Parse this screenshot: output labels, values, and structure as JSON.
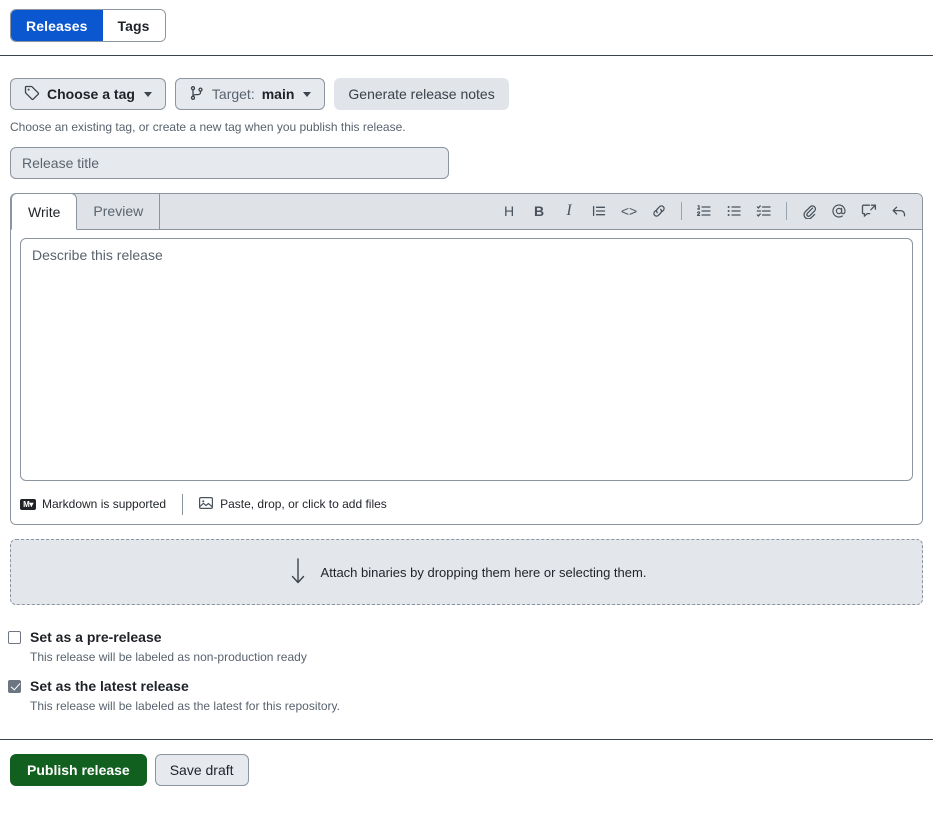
{
  "tabs": {
    "releases": "Releases",
    "tags": "Tags",
    "active": "Releases"
  },
  "tag_row": {
    "choose_tag": "Choose a tag",
    "target_label": "Target:",
    "target_value": "main",
    "generate_notes": "Generate release notes",
    "hint": "Choose an existing tag, or create a new tag when you publish this release."
  },
  "title_field": {
    "placeholder": "Release title",
    "value": ""
  },
  "editor": {
    "tab_write": "Write",
    "tab_preview": "Preview",
    "active_tab": "Write",
    "body_placeholder": "Describe this release",
    "body_value": "",
    "toolbar": [
      {
        "name": "heading-icon",
        "glyph": "H"
      },
      {
        "name": "bold-icon",
        "glyph": "B"
      },
      {
        "name": "italic-icon",
        "glyph": "I"
      },
      {
        "name": "quote-icon",
        "glyph": ""
      },
      {
        "name": "code-icon",
        "glyph": "<>"
      },
      {
        "name": "link-icon",
        "glyph": ""
      },
      {
        "name": "ordered-list-icon",
        "glyph": ""
      },
      {
        "name": "unordered-list-icon",
        "glyph": ""
      },
      {
        "name": "task-list-icon",
        "glyph": ""
      },
      {
        "name": "attach-file-icon",
        "glyph": ""
      },
      {
        "name": "mention-icon",
        "glyph": "@"
      },
      {
        "name": "cross-reference-icon",
        "glyph": ""
      },
      {
        "name": "saved-reply-icon",
        "glyph": ""
      }
    ],
    "footer": {
      "markdown_badge": "M",
      "markdown_text": "Markdown is supported",
      "attach_text": "Paste, drop, or click to add files"
    }
  },
  "dropzone": {
    "text": "Attach binaries by dropping them here or selecting them."
  },
  "options": [
    {
      "id": "pre-release",
      "label": "Set as a pre-release",
      "description": "This release will be labeled as non-production ready",
      "checked": false
    },
    {
      "id": "latest-release",
      "label": "Set as the latest release",
      "description": "This release will be labeled as the latest for this repository.",
      "checked": true
    }
  ],
  "actions": {
    "publish": "Publish release",
    "save_draft": "Save draft"
  },
  "colors": {
    "accent_blue": "#0b57d0",
    "publish_green": "#12601f",
    "border": "#8c959f",
    "muted_text": "#59636e",
    "surface": "#e6eaef"
  }
}
